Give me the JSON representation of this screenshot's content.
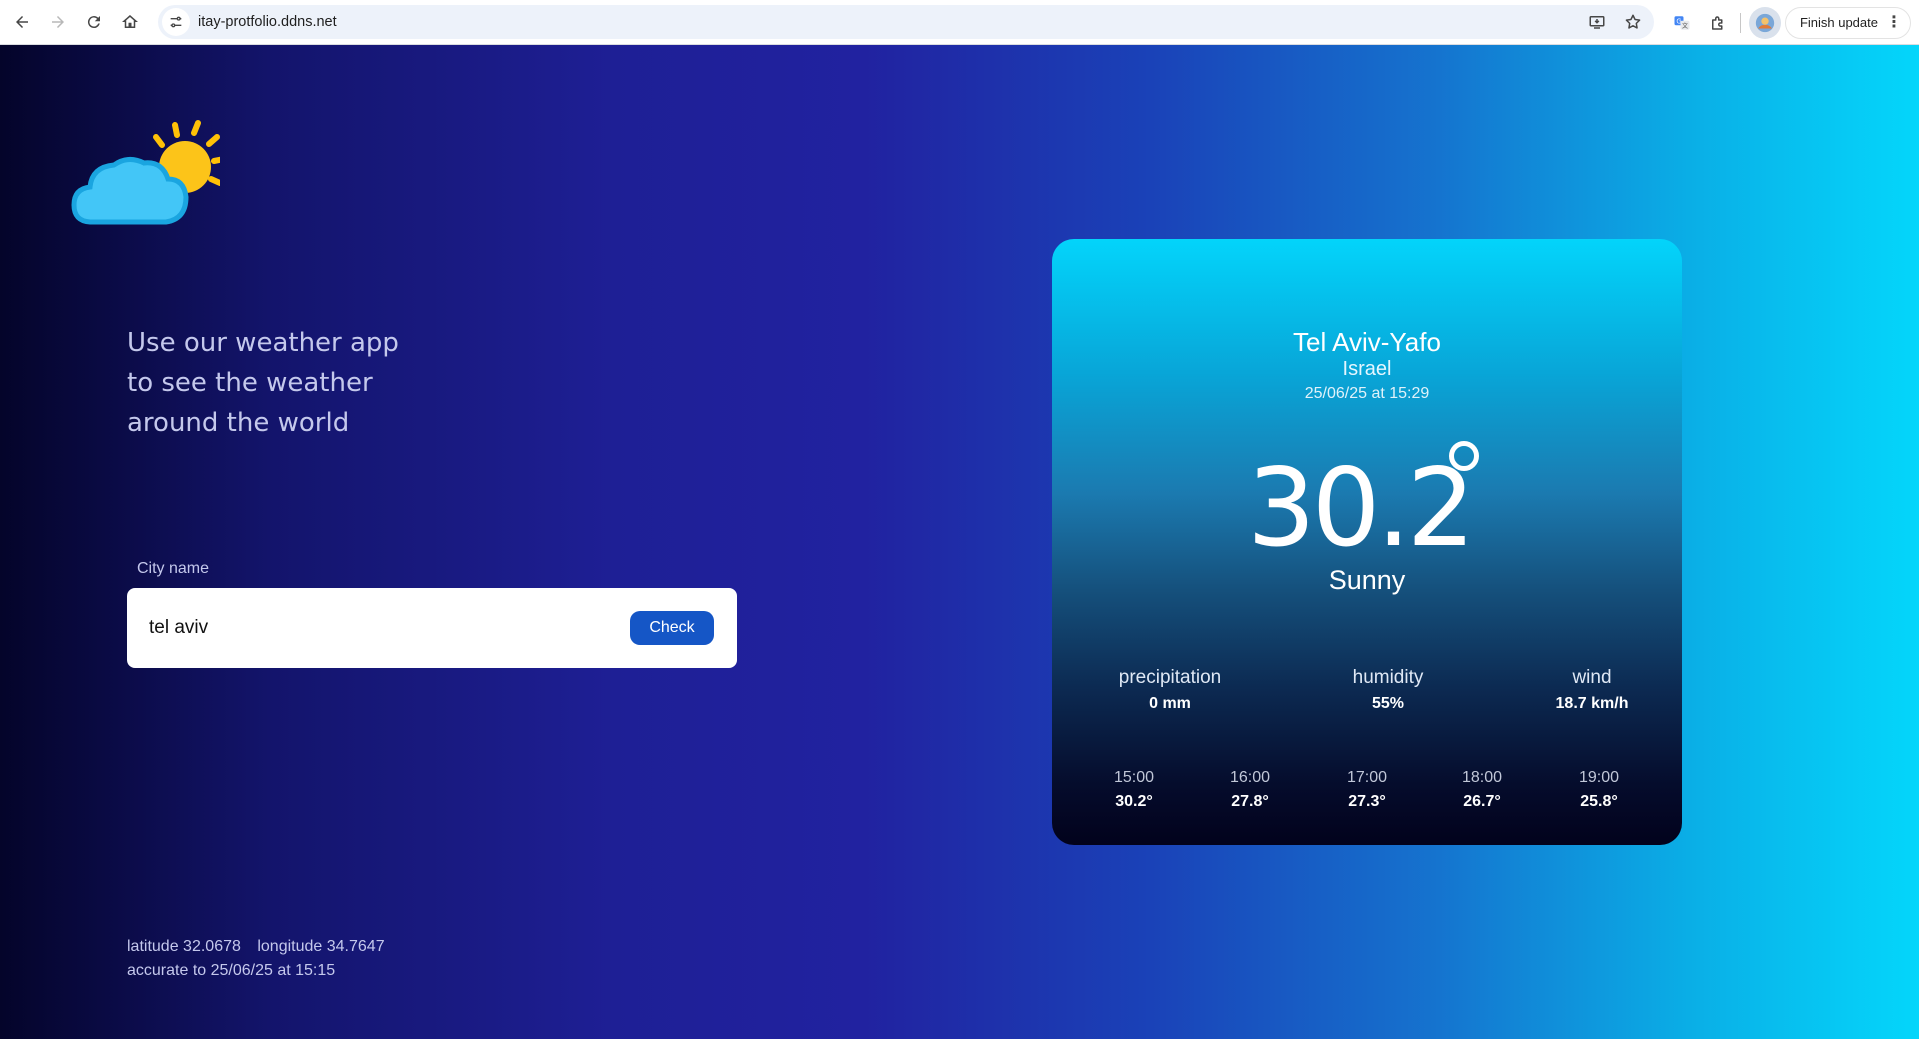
{
  "browser": {
    "url": "itay-protfolio.ddns.net",
    "update_label": "Finish update"
  },
  "app": {
    "tagline": "Use our weather app\nto see the weather\naround the world",
    "city_label": "City name",
    "city_value": "tel aviv",
    "check_label": "Check",
    "location": {
      "latitude_label": "latitude",
      "latitude": "32.0678",
      "longitude_label": "longitude",
      "longitude": "34.7647",
      "accurate_label": "accurate to",
      "accurate_time": "25/06/25 at 15:15"
    }
  },
  "weather": {
    "city": "Tel Aviv-Yafo",
    "country": "Israel",
    "timestamp": "25/06/25 at 15:29",
    "temperature": "30.2",
    "condition": "Sunny",
    "stats": [
      {
        "label": "precipitation",
        "value": "0 mm"
      },
      {
        "label": "humidity",
        "value": "55%"
      },
      {
        "label": "wind",
        "value": "18.7 km/h"
      }
    ],
    "hourly": [
      {
        "time": "15:00",
        "temp": "30.2°"
      },
      {
        "time": "16:00",
        "temp": "27.8°"
      },
      {
        "time": "17:00",
        "temp": "27.3°"
      },
      {
        "time": "18:00",
        "temp": "26.7°"
      },
      {
        "time": "19:00",
        "temp": "25.8°"
      }
    ]
  },
  "colors": {
    "accent_button": "#1556c6",
    "card_top": "#03d4fb",
    "card_bottom": "#02021c"
  }
}
